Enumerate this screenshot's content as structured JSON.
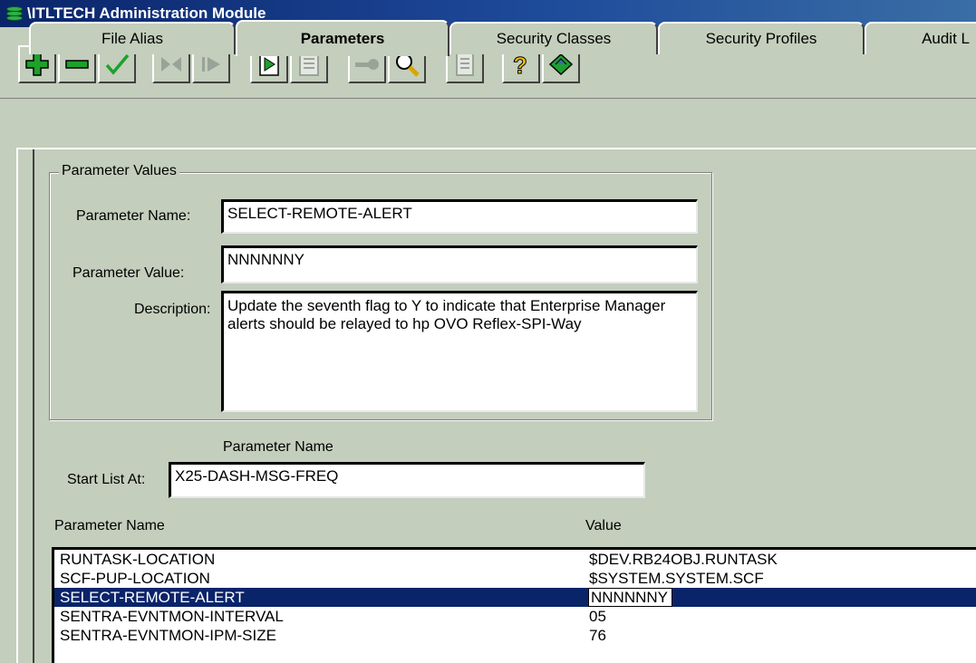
{
  "window": {
    "title": "\\ITLTECH Administration Module"
  },
  "toolbar": {
    "buttons": [
      {
        "name": "add-record-button",
        "icon": "plus-icon"
      },
      {
        "name": "delete-record-button",
        "icon": "minus-icon"
      },
      {
        "name": "confirm-button",
        "icon": "checkmark-icon"
      },
      {
        "name": "previous-button",
        "icon": "skip-back-icon"
      },
      {
        "name": "next-button",
        "icon": "play-next-icon"
      },
      {
        "name": "report-button",
        "icon": "document-play-icon"
      },
      {
        "name": "document-button",
        "icon": "document-icon"
      },
      {
        "name": "security-key-button",
        "icon": "key-icon"
      },
      {
        "name": "search-button",
        "icon": "magnifier-icon"
      },
      {
        "name": "log-button",
        "icon": "log-icon"
      },
      {
        "name": "help-button",
        "icon": "help-icon"
      },
      {
        "name": "exit-button",
        "icon": "exit-icon"
      }
    ]
  },
  "tabs": [
    {
      "label": "File Alias",
      "active": false
    },
    {
      "label": "Parameters",
      "active": true
    },
    {
      "label": "Security Classes",
      "active": false
    },
    {
      "label": "Security Profiles",
      "active": false
    },
    {
      "label": "Audit L",
      "active": false
    }
  ],
  "parameter_values": {
    "legend": "Parameter Values",
    "name_label": "Parameter Name:",
    "name_value": "SELECT-REMOTE-ALERT",
    "value_label": "Parameter Value:",
    "value_value": "NNNNNNY",
    "description_label": "Description:",
    "description_value": "Update the seventh flag to Y to indicate that Enterprise Manager alerts should be relayed to hp OVO Reflex-SPI-Way"
  },
  "start_list": {
    "header": "Parameter Name",
    "label": "Start List At:",
    "value": "X25-DASH-MSG-FREQ"
  },
  "list": {
    "columns": [
      "Parameter Name",
      "Value"
    ],
    "rows": [
      {
        "name": "RUNTASK-LOCATION",
        "value": "$DEV.RB24OBJ.RUNTASK",
        "selected": false
      },
      {
        "name": "SCF-PUP-LOCATION",
        "value": "$SYSTEM.SYSTEM.SCF",
        "selected": false
      },
      {
        "name": "SELECT-REMOTE-ALERT",
        "value": "NNNNNNY",
        "selected": true
      },
      {
        "name": "SENTRA-EVNTMON-INTERVAL",
        "value": "05",
        "selected": false
      },
      {
        "name": "SENTRA-EVNTMON-IPM-SIZE",
        "value": "76",
        "selected": false
      }
    ]
  },
  "colors": {
    "titlebar": "#0a246a",
    "background": "#c3cebc",
    "selection": "#0a246a"
  }
}
